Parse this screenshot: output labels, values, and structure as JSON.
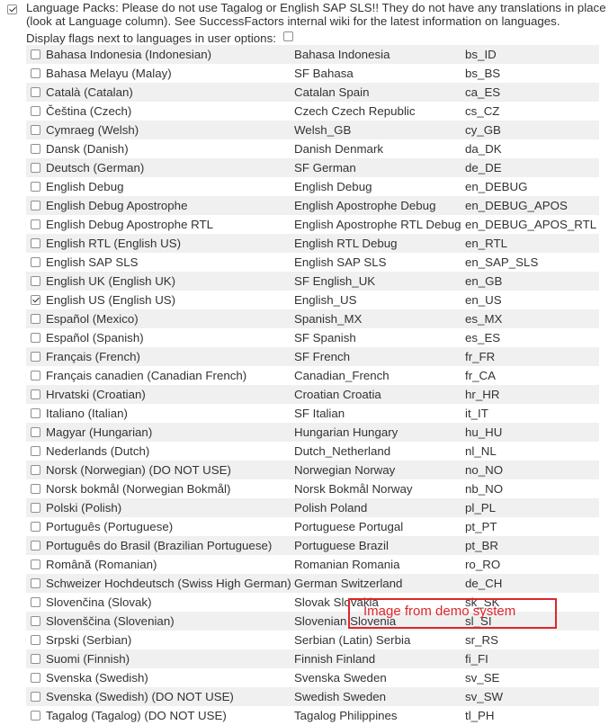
{
  "language_packs": {
    "checked": true,
    "text": "Language Packs: Please do not use Tagalog or English SAP SLS!! They do not have any translations in place (look at Language column). See SuccessFactors internal wiki for the latest information on languages."
  },
  "display_flags": {
    "label": "Display flags next to languages in user options:",
    "checked": false
  },
  "languages": [
    {
      "label": "Bahasa Indonesia (Indonesian)",
      "name": "Bahasa Indonesia",
      "code": "bs_ID",
      "checked": false
    },
    {
      "label": "Bahasa Melayu (Malay)",
      "name": "SF Bahasa",
      "code": "bs_BS",
      "checked": false
    },
    {
      "label": "Català (Catalan)",
      "name": "Catalan Spain",
      "code": "ca_ES",
      "checked": false
    },
    {
      "label": "Čeština (Czech)",
      "name": "Czech Czech Republic",
      "code": "cs_CZ",
      "checked": false
    },
    {
      "label": "Cymraeg (Welsh)",
      "name": "Welsh_GB",
      "code": "cy_GB",
      "checked": false
    },
    {
      "label": "Dansk (Danish)",
      "name": "Danish Denmark",
      "code": "da_DK",
      "checked": false
    },
    {
      "label": "Deutsch (German)",
      "name": "SF German",
      "code": "de_DE",
      "checked": false
    },
    {
      "label": "English Debug",
      "name": "English Debug",
      "code": "en_DEBUG",
      "checked": false
    },
    {
      "label": "English Debug Apostrophe",
      "name": "English Apostrophe Debug",
      "code": "en_DEBUG_APOS",
      "checked": false
    },
    {
      "label": "English Debug Apostrophe RTL",
      "name": "English Apostrophe RTL Debug",
      "code": "en_DEBUG_APOS_RTL",
      "checked": false
    },
    {
      "label": "English RTL (English US)",
      "name": "English RTL Debug",
      "code": "en_RTL",
      "checked": false
    },
    {
      "label": "English SAP SLS",
      "name": "English SAP SLS",
      "code": "en_SAP_SLS",
      "checked": false
    },
    {
      "label": "English UK (English UK)",
      "name": "SF English_UK",
      "code": "en_GB",
      "checked": false
    },
    {
      "label": "English US (English US)",
      "name": "English_US",
      "code": "en_US",
      "checked": true
    },
    {
      "label": "Español (Mexico)",
      "name": "Spanish_MX",
      "code": "es_MX",
      "checked": false
    },
    {
      "label": "Español (Spanish)",
      "name": "SF Spanish",
      "code": "es_ES",
      "checked": false
    },
    {
      "label": "Français (French)",
      "name": "SF French",
      "code": "fr_FR",
      "checked": false
    },
    {
      "label": "Français canadien (Canadian French)",
      "name": "Canadian_French",
      "code": "fr_CA",
      "checked": false
    },
    {
      "label": "Hrvatski (Croatian)",
      "name": "Croatian Croatia",
      "code": "hr_HR",
      "checked": false
    },
    {
      "label": "Italiano (Italian)",
      "name": "SF Italian",
      "code": "it_IT",
      "checked": false
    },
    {
      "label": "Magyar (Hungarian)",
      "name": "Hungarian Hungary",
      "code": "hu_HU",
      "checked": false
    },
    {
      "label": "Nederlands (Dutch)",
      "name": "Dutch_Netherland",
      "code": "nl_NL",
      "checked": false
    },
    {
      "label": "Norsk (Norwegian) (DO NOT USE)",
      "name": "Norwegian Norway",
      "code": "no_NO",
      "checked": false
    },
    {
      "label": "Norsk bokmål (Norwegian Bokmål)",
      "name": "Norsk Bokmål Norway",
      "code": "nb_NO",
      "checked": false
    },
    {
      "label": "Polski (Polish)",
      "name": "Polish Poland",
      "code": "pl_PL",
      "checked": false
    },
    {
      "label": "Português (Portuguese)",
      "name": "Portuguese Portugal",
      "code": "pt_PT",
      "checked": false
    },
    {
      "label": "Português do Brasil (Brazilian Portuguese)",
      "name": "Portuguese Brazil",
      "code": "pt_BR",
      "checked": false
    },
    {
      "label": "Română (Romanian)",
      "name": "Romanian Romania",
      "code": "ro_RO",
      "checked": false
    },
    {
      "label": "Schweizer Hochdeutsch (Swiss High German)",
      "name": "German Switzerland",
      "code": "de_CH",
      "checked": false
    },
    {
      "label": "Slovenčina (Slovak)",
      "name": "Slovak Slovakia",
      "code": "sk_SK",
      "checked": false
    },
    {
      "label": "Slovenščina (Slovenian)",
      "name": "Slovenian Slovenia",
      "code": "sl_SI",
      "checked": false
    },
    {
      "label": "Srpski (Serbian)",
      "name": "Serbian (Latin) Serbia",
      "code": "sr_RS",
      "checked": false
    },
    {
      "label": "Suomi (Finnish)",
      "name": "Finnish Finland",
      "code": "fi_FI",
      "checked": false
    },
    {
      "label": "Svenska (Swedish)",
      "name": "Svenska Sweden",
      "code": "sv_SE",
      "checked": false
    },
    {
      "label": "Svenska (Swedish) (DO NOT USE)",
      "name": "Swedish Sweden",
      "code": "sv_SW",
      "checked": false
    },
    {
      "label": "Tagalog (Tagalog) (DO NOT USE)",
      "name": "Tagalog Philippines",
      "code": "tl_PH",
      "checked": false
    }
  ],
  "annotation": {
    "text": "Image from demo system",
    "color": "#e0262a"
  }
}
